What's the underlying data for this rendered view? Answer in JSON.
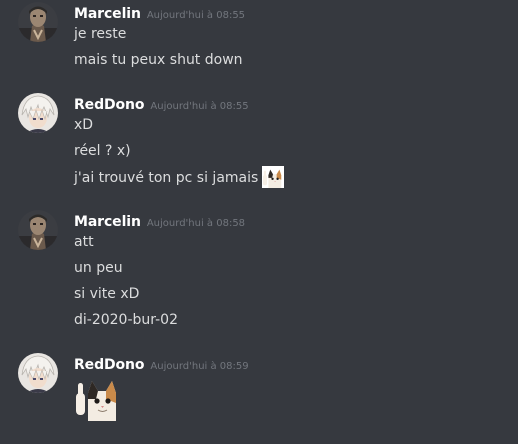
{
  "channel": {
    "groups": [
      {
        "author": "Marcelin",
        "timestamp": "Aujourd'hui à 08:55",
        "messages": [
          "je reste",
          "mais tu peux shut down"
        ]
      },
      {
        "author": "RedDono",
        "timestamp": "Aujourd'hui à 08:55",
        "messages": [
          "xD",
          "réel ? x)",
          "j'ai trouvé ton pc si jamais"
        ]
      },
      {
        "author": "Marcelin",
        "timestamp": "Aujourd'hui à 08:58",
        "messages": [
          "att",
          "un peu",
          "si vite xD",
          "di-2020-bur-02"
        ]
      },
      {
        "author": "RedDono",
        "timestamp": "Aujourd'hui à 08:59",
        "messages": []
      }
    ]
  },
  "colors": {
    "background": "#36393f",
    "username": "#ffffff",
    "message_text": "#dcddde",
    "timestamp": "#72767d"
  },
  "icons": {
    "avatar_marcelin": "dark-hooded-figure-avatar",
    "avatar_reddono": "white-haired-character-avatar",
    "emoji": "cat-thumbs-up-emoji"
  }
}
